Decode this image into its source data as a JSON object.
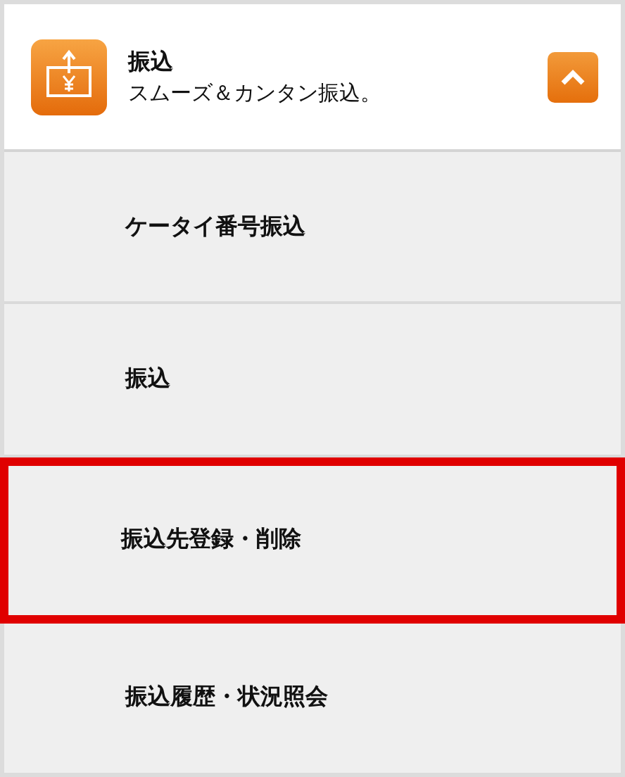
{
  "header": {
    "title": "振込",
    "subtitle": "スムーズ＆カンタン振込。",
    "expanded": true
  },
  "items": [
    {
      "label": "ケータイ番号振込",
      "selected": false
    },
    {
      "label": "振込",
      "selected": false
    },
    {
      "label": "振込先登録・削除",
      "selected": true
    },
    {
      "label": "振込履歴・状況照会",
      "selected": false
    }
  ]
}
